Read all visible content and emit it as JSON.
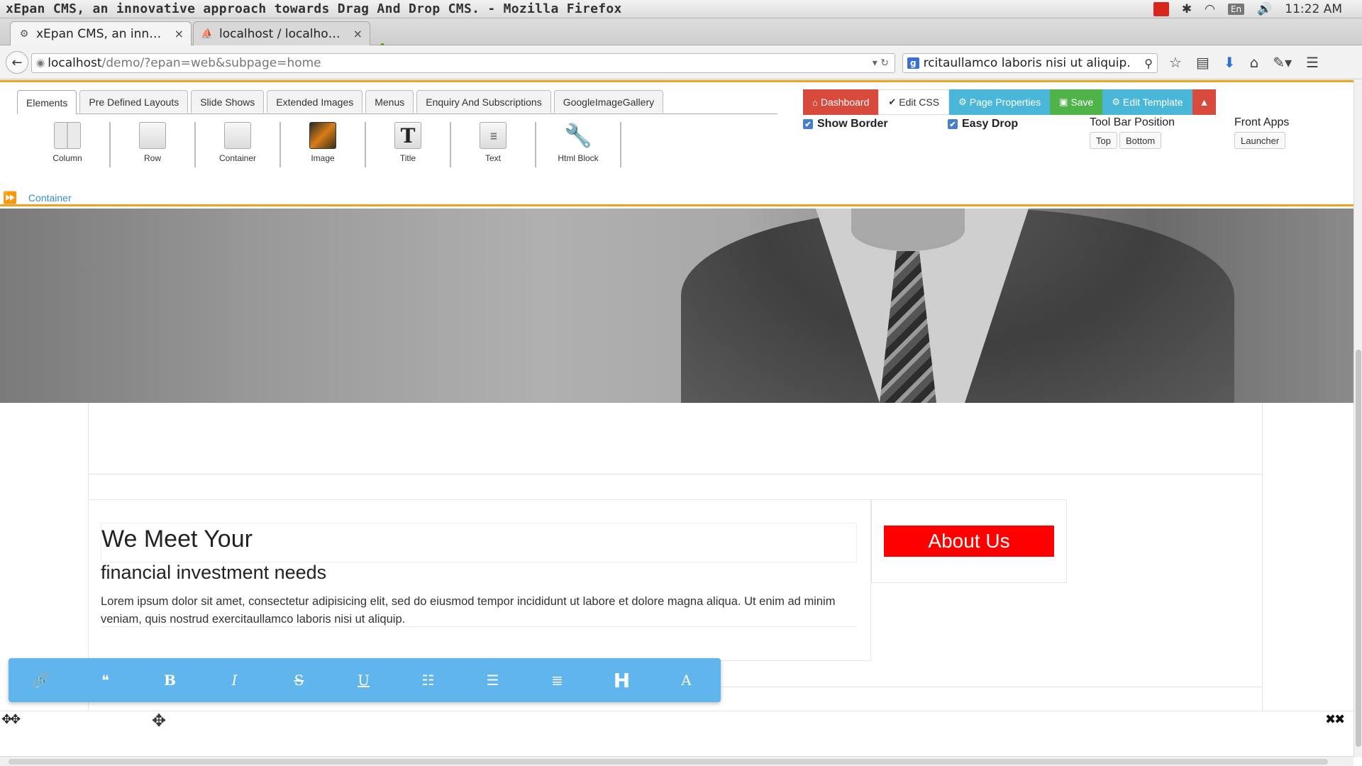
{
  "window": {
    "title": "xEpan CMS, an innovative approach towards Drag And Drop CMS. - Mozilla Firefox",
    "clock": "11:22 AM",
    "keyboard_layout": "En"
  },
  "browser": {
    "tabs": [
      {
        "label": "xEpan CMS, an inn…",
        "active": true
      },
      {
        "label": "localhost / localho…",
        "active": false
      }
    ],
    "url_host": "localhost",
    "url_path": "/demo/?epan=web&subpage=home",
    "search_text": "rcitaullamco laboris nisi ut aliquip."
  },
  "cms": {
    "tabs": [
      "Elements",
      "Pre Defined Layouts",
      "Slide Shows",
      "Extended Images",
      "Menus",
      "Enquiry And Subscriptions",
      "GoogleImageGallery"
    ],
    "elements": [
      "Column",
      "Row",
      "Container",
      "Image",
      "Title",
      "Text",
      "Html Block"
    ],
    "buttons": {
      "dashboard": "Dashboard",
      "edit_css": "Edit CSS",
      "page_properties": "Page Properties",
      "save": "Save",
      "edit_template": "Edit Template"
    },
    "options": {
      "show_border": "Show Border",
      "easy_drop": "Easy Drop",
      "toolbar_position_label": "Tool Bar Position",
      "top": "Top",
      "bottom": "Bottom",
      "front_apps_label": "Front Apps",
      "launcher": "Launcher"
    },
    "breadcrumb": "Container"
  },
  "page": {
    "heading": "We Meet Your",
    "subheading": "financial investment needs",
    "paragraph": "Lorem ipsum dolor sit amet, consectetur adipisicing elit, sed do eiusmod tempor incididunt ut labore et dolore magna aliqua. Ut enim ad minim veniam, quis nostrud exercitaullamco laboris nisi ut aliquip.",
    "about_button": "About Us"
  },
  "editor_toolbar": {
    "bold": "B",
    "italic": "I",
    "strike": "S",
    "underline": "U",
    "heading": "H",
    "font": "A"
  },
  "colors": {
    "accent_orange": "#f0a31a",
    "dashboard_red": "#d84a3c",
    "info_blue": "#4bb7d8",
    "save_green": "#4fb34a",
    "about_red": "#ff0000",
    "editor_blue": "#5fb5ec"
  }
}
